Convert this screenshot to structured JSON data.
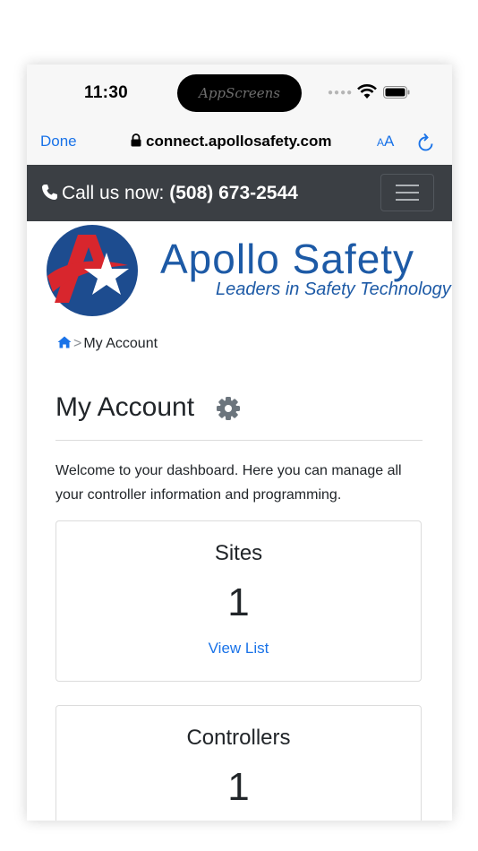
{
  "status_bar": {
    "time": "11:30",
    "island_watermark": "AppScreens"
  },
  "browser": {
    "done_label": "Done",
    "url": "connect.apollosafety.com",
    "text_size_small": "A",
    "text_size_big": "A"
  },
  "topbar": {
    "call_label": "Call us now:",
    "phone_number": "(508) 673-2544"
  },
  "brand": {
    "name": "Apollo Safety",
    "tagline": "Leaders in Safety Technology"
  },
  "breadcrumb": {
    "separator": ">",
    "current": "My Account"
  },
  "page": {
    "title": "My Account",
    "intro": "Welcome to your dashboard. Here you can manage all your controller information and programming."
  },
  "cards": [
    {
      "title": "Sites",
      "count": "1",
      "link": "View List"
    },
    {
      "title": "Controllers",
      "count": "1"
    }
  ],
  "colors": {
    "nav_bg": "#3b3f44",
    "brand_blue": "#1d5aa6",
    "link_blue": "#1a73e8",
    "logo_red": "#d8262d"
  }
}
